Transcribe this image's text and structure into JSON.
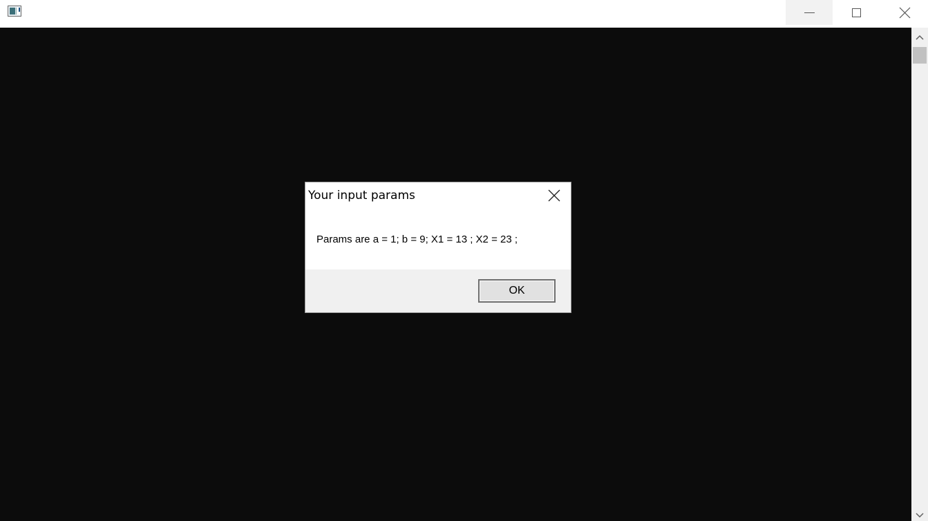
{
  "window": {
    "title": "",
    "icon": "console-window-icon",
    "controls": {
      "minimize": "minimize-icon",
      "maximize": "maximize-icon",
      "close": "close-icon"
    },
    "background": "#0c0c0c"
  },
  "dialog": {
    "title": "Your input params",
    "message": "Params are a = 1; b = 9; X1 = 13 ; X2 = 23 ;",
    "ok_label": "OK",
    "close_icon": "close-icon"
  }
}
